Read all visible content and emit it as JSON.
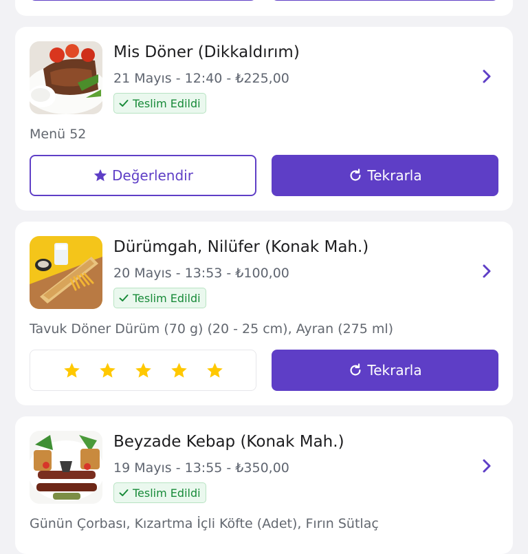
{
  "orders": [
    {
      "restaurant": "Mis Döner (Dikkaldırım)",
      "date_time_price": "21 Mayıs - 12:40 - ₺225,00",
      "status": "Teslim Edildi",
      "items": "Menü 52",
      "rate_label": "Değerlendir",
      "repeat_label": "Tekrarla"
    },
    {
      "restaurant": "Dürümgah, Nilüfer (Konak Mah.)",
      "date_time_price": "20 Mayıs - 13:53 - ₺100,00",
      "status": "Teslim Edildi",
      "items": "Tavuk Döner Dürüm (70 g) (20 - 25 cm), Ayran (275 ml)",
      "rating": 5,
      "repeat_label": "Tekrarla"
    },
    {
      "restaurant": "Beyzade Kebap (Konak Mah.)",
      "date_time_price": "19 Mayıs - 13:55 - ₺350,00",
      "status": "Teslim Edildi",
      "items": "Günün Çorbası, Kızartma İçli Köfte (Adet), Fırın Sütlaç"
    }
  ],
  "colors": {
    "primary": "#5e3ec6",
    "delivered_green": "#178a38",
    "star": "#ffc800",
    "background": "#f2f2f5"
  },
  "icons": [
    "chevron-right-icon",
    "check-icon",
    "star-icon",
    "refresh-icon"
  ]
}
